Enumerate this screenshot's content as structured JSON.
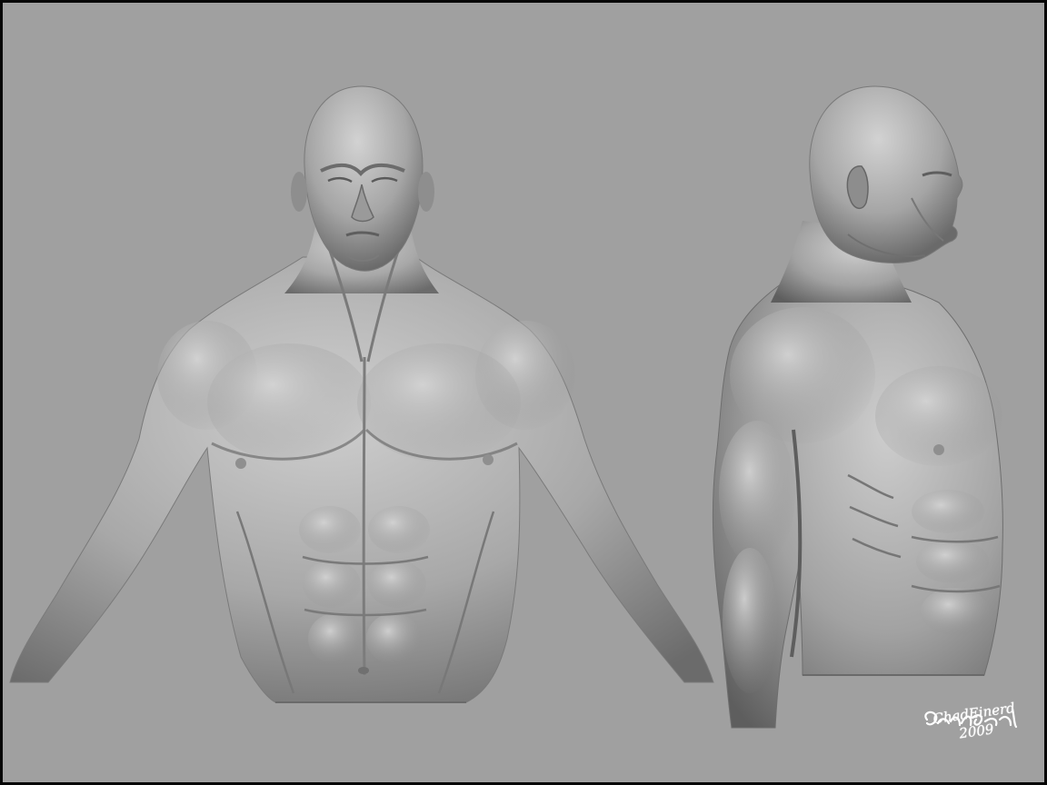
{
  "signature": {
    "name": "ChadEinerd",
    "year": "2009"
  },
  "colors": {
    "background": "#a0a0a0",
    "border": "#050505",
    "sculpt_light": "#c8c8c8",
    "sculpt_mid": "#9c9c9c",
    "sculpt_dark": "#555555",
    "signature": "#ffffff"
  }
}
